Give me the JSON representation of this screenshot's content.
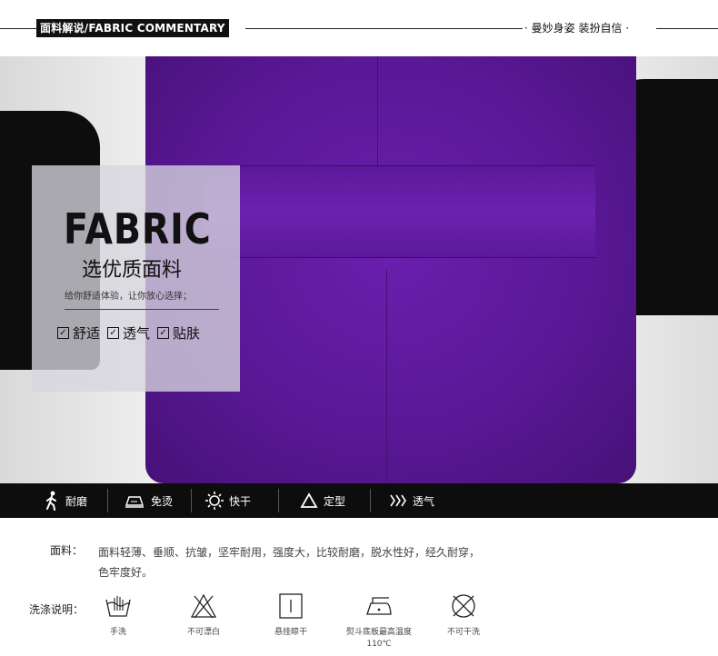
{
  "header": {
    "title": "面料解说/FABRIC COMMENTARY",
    "slogan": "· 曼妙身姿  装扮自信 ·"
  },
  "panel": {
    "big_title": "FABRIC",
    "subtitle": "选优质面料",
    "description": "给你舒适体验，让你放心选择；",
    "checks": [
      "舒适",
      "透气",
      "贴肤"
    ]
  },
  "features": [
    {
      "label": "耐磨",
      "icon": "walking-person-icon"
    },
    {
      "label": "免烫",
      "icon": "iron-icon"
    },
    {
      "label": "快干",
      "icon": "sun-icon"
    },
    {
      "label": "定型",
      "icon": "triangle-icon"
    },
    {
      "label": "透气",
      "icon": "wave-icon"
    }
  ],
  "fabric": {
    "label": "面料：",
    "text": "面料轻薄、垂顺、抗皱，坚牢耐用，强度大，比较耐磨，脱水性好，经久耐穿，色牢度好。"
  },
  "wash": {
    "label": "洗涤说明：",
    "items": [
      {
        "caption": "手洗",
        "icon": "hand-wash-icon"
      },
      {
        "caption": "不可漂白",
        "icon": "no-bleach-icon"
      },
      {
        "caption": "悬挂晾干",
        "icon": "hang-dry-icon"
      },
      {
        "caption": "熨斗底板最高温度110℃",
        "icon": "iron-temp-icon"
      },
      {
        "caption": "不可干洗",
        "icon": "no-dry-clean-icon"
      }
    ]
  },
  "colors": {
    "dress": "#5a1896",
    "bar": "#0d0d0d",
    "panel": "#d6d6de"
  }
}
